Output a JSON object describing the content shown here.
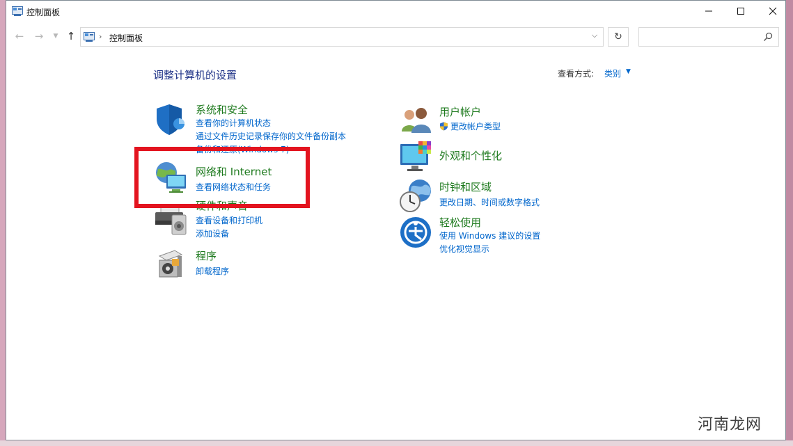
{
  "window": {
    "title": "控制面板",
    "min_icon": "minimize-icon",
    "max_icon": "maximize-icon",
    "close_icon": "close-icon"
  },
  "nav": {
    "breadcrumb": "控制面板",
    "search_placeholder": ""
  },
  "main": {
    "heading": "调整计算机的设置",
    "view_by_label": "查看方式:",
    "view_by_value": "类别"
  },
  "categories": [
    {
      "title": "系统和安全",
      "icon": "shield-icon",
      "links": [
        "查看你的计算机状态",
        "通过文件历史记录保存你的文件备份副本",
        "备份和还原(Windows 7)"
      ]
    },
    {
      "title": "网络和 Internet",
      "icon": "network-icon",
      "links": [
        "查看网络状态和任务"
      ]
    },
    {
      "title": "硬件和声音",
      "icon": "printer-icon",
      "links": [
        "查看设备和打印机",
        "添加设备"
      ]
    },
    {
      "title": "程序",
      "icon": "programs-icon",
      "links": [
        "卸载程序"
      ]
    },
    {
      "title": "用户帐户",
      "icon": "users-icon",
      "links": [
        "更改帐户类型"
      ]
    },
    {
      "title": "外观和个性化",
      "icon": "appearance-icon",
      "links": []
    },
    {
      "title": "时钟和区域",
      "icon": "clock-icon",
      "links": [
        "更改日期、时间或数字格式"
      ]
    },
    {
      "title": "轻松使用",
      "icon": "ease-of-access-icon",
      "links": [
        "使用 Windows 建议的设置",
        "优化视觉显示"
      ]
    }
  ],
  "watermark": "河南龙网",
  "colors": {
    "title_green": "#1e7a1e",
    "link_blue": "#0066cc",
    "heading_blue": "#1e3287",
    "annotation_red": "#e3141f"
  }
}
